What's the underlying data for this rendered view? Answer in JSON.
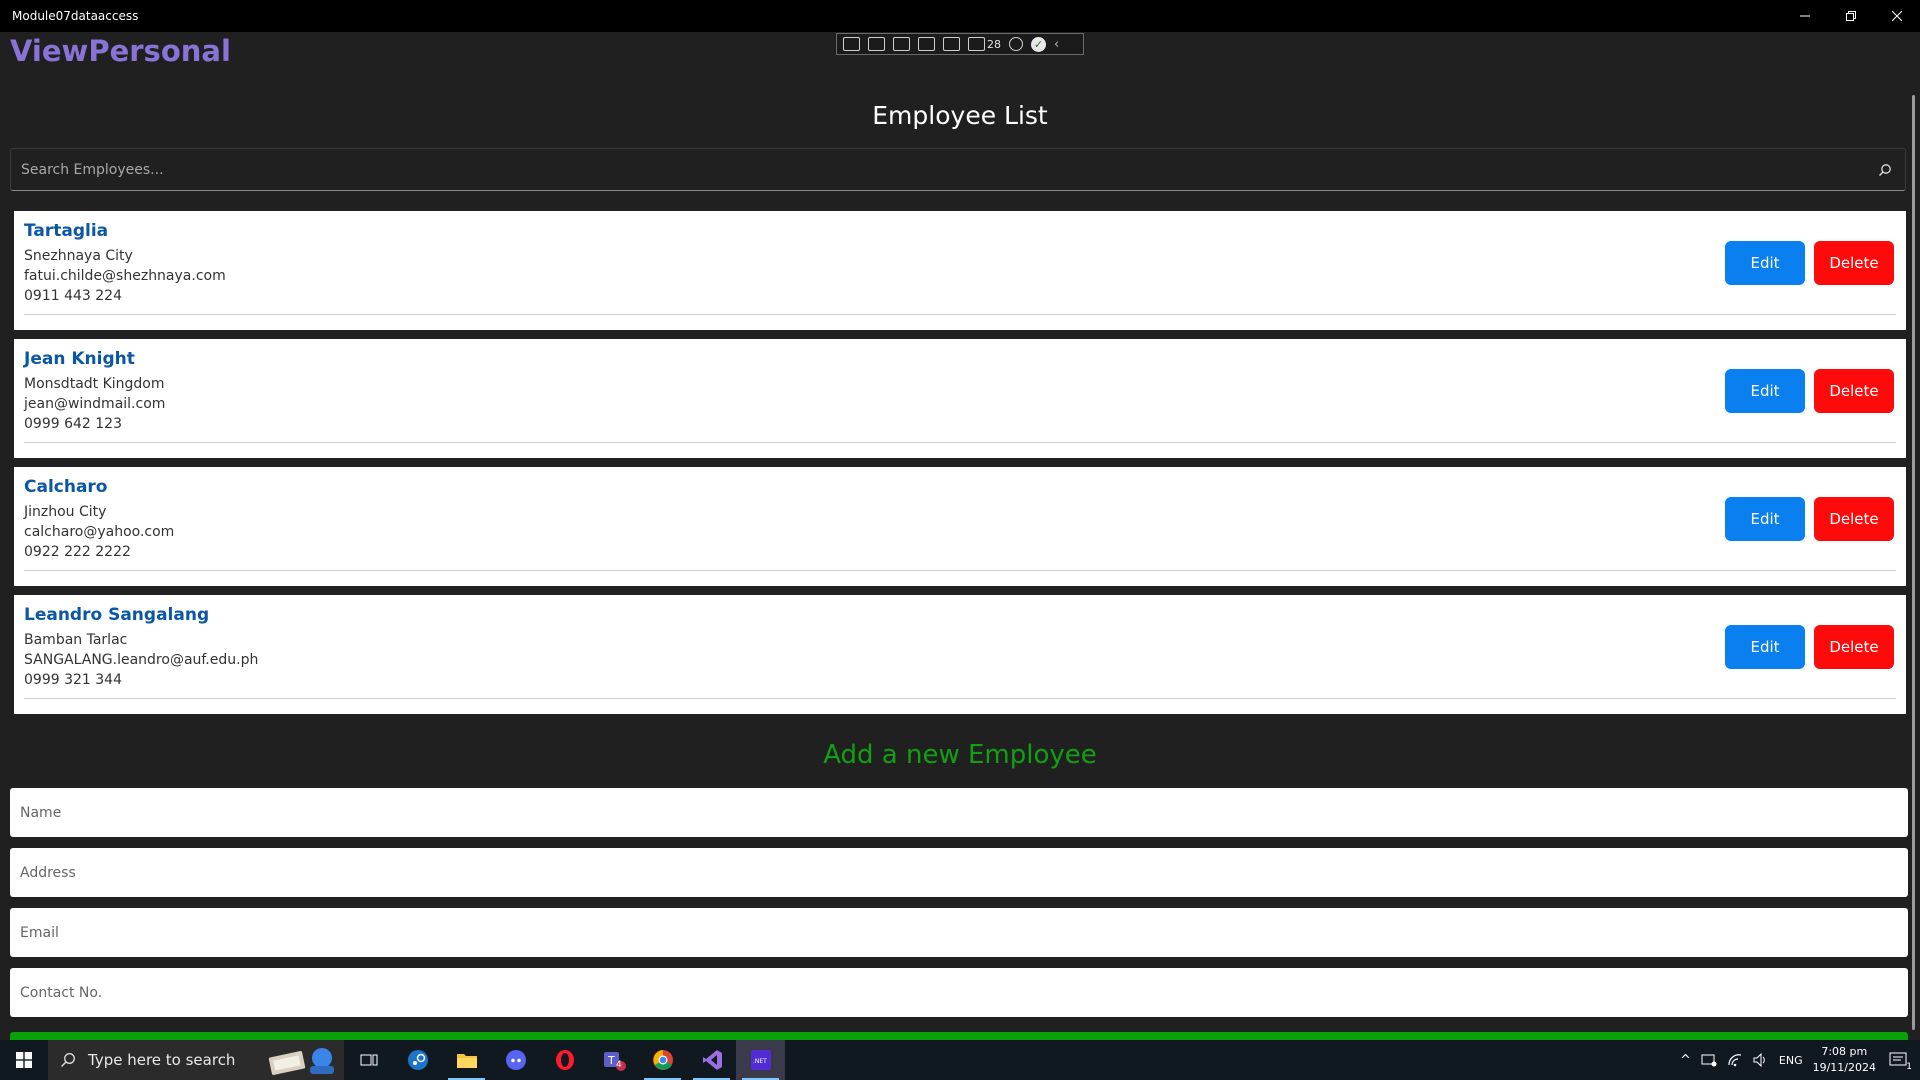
{
  "window": {
    "title": "Module07dataaccess"
  },
  "app": {
    "title": "ViewPersonal"
  },
  "debug_toolbar": {
    "count": "28"
  },
  "page": {
    "title": "Employee List"
  },
  "search": {
    "placeholder": "Search Employees..."
  },
  "employees": [
    {
      "name": "Tartaglia",
      "address": "Snezhnaya City",
      "email": "fatui.childe@shezhnaya.com",
      "contact": "0911 443 224",
      "edit_label": "Edit",
      "delete_label": "Delete"
    },
    {
      "name": "Jean Knight",
      "address": "Monsdtadt Kingdom",
      "email": "jean@windmail.com",
      "contact": "0999 642 123",
      "edit_label": "Edit",
      "delete_label": "Delete"
    },
    {
      "name": "Calcharo",
      "address": "Jinzhou City",
      "email": "calcharo@yahoo.com",
      "contact": "0922 222 2222",
      "edit_label": "Edit",
      "delete_label": "Delete"
    },
    {
      "name": "Leandro Sangalang",
      "address": "Bamban Tarlac",
      "email": "SANGALANG.leandro@auf.edu.ph",
      "contact": "0999 321 344",
      "edit_label": "Edit",
      "delete_label": "Delete"
    }
  ],
  "add_form": {
    "title": "Add a new Employee",
    "name_placeholder": "Name",
    "address_placeholder": "Address",
    "email_placeholder": "Email",
    "contact_placeholder": "Contact No."
  },
  "taskbar": {
    "search_placeholder": "Type here to search",
    "teams_badge": "4",
    "language": "ENG",
    "time": "7:08 pm",
    "date": "19/11/2024",
    "notification_count": "1"
  },
  "colors": {
    "accent_purple": "#8a73d6",
    "name_blue": "#0b57a4",
    "edit_blue": "#0a7ff0",
    "delete_red": "#ff0a0a",
    "add_green": "#10a010"
  }
}
